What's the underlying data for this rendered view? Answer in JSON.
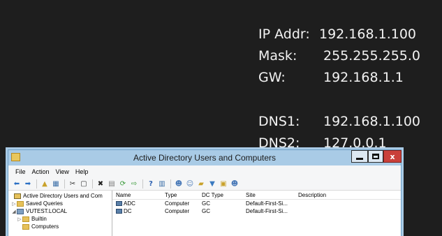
{
  "info": {
    "ip_label": "IP Addr:",
    "ip_value": "192.168.1.100",
    "mask_label": "Mask:",
    "mask_value": "255.255.255.0",
    "gw_label": "GW:",
    "gw_value": "192.168.1.1",
    "dns1_label": "DNS1:",
    "dns1_value": "192.168.1.100",
    "dns2_label": "DNS2:",
    "dns2_value": "127.0.0.1"
  },
  "window": {
    "title": "Active Directory Users and Computers",
    "close_glyph": "x"
  },
  "menu": [
    "File",
    "Action",
    "View",
    "Help"
  ],
  "tree": {
    "root": "Active Directory Users and Com",
    "saved_queries": "Saved Queries",
    "domain": "VUTEST.LOCAL",
    "builtin": "Builtin",
    "computers": "Computers"
  },
  "list": {
    "headers": [
      "Name",
      "Type",
      "DC Type",
      "Site",
      "Description"
    ],
    "rows": [
      [
        "ADC",
        "Computer",
        "GC",
        "Default-First-Si...",
        ""
      ],
      [
        "DC",
        "Computer",
        "GC",
        "Default-First-Si...",
        ""
      ]
    ]
  },
  "colors": {
    "desktop": "#1e1e1e",
    "titlebar": "#a9cbe6",
    "close": "#c9403a"
  },
  "icons": [
    "back-icon",
    "forward-icon",
    "up-folder-icon",
    "console-tree-icon",
    "cut-icon",
    "copy-icon",
    "delete-icon",
    "properties-icon",
    "refresh-icon",
    "export-icon",
    "help-icon",
    "view-icon",
    "user-icon",
    "group-icon",
    "ou-icon",
    "filter-icon",
    "find-icon",
    "add-to-group-icon"
  ]
}
